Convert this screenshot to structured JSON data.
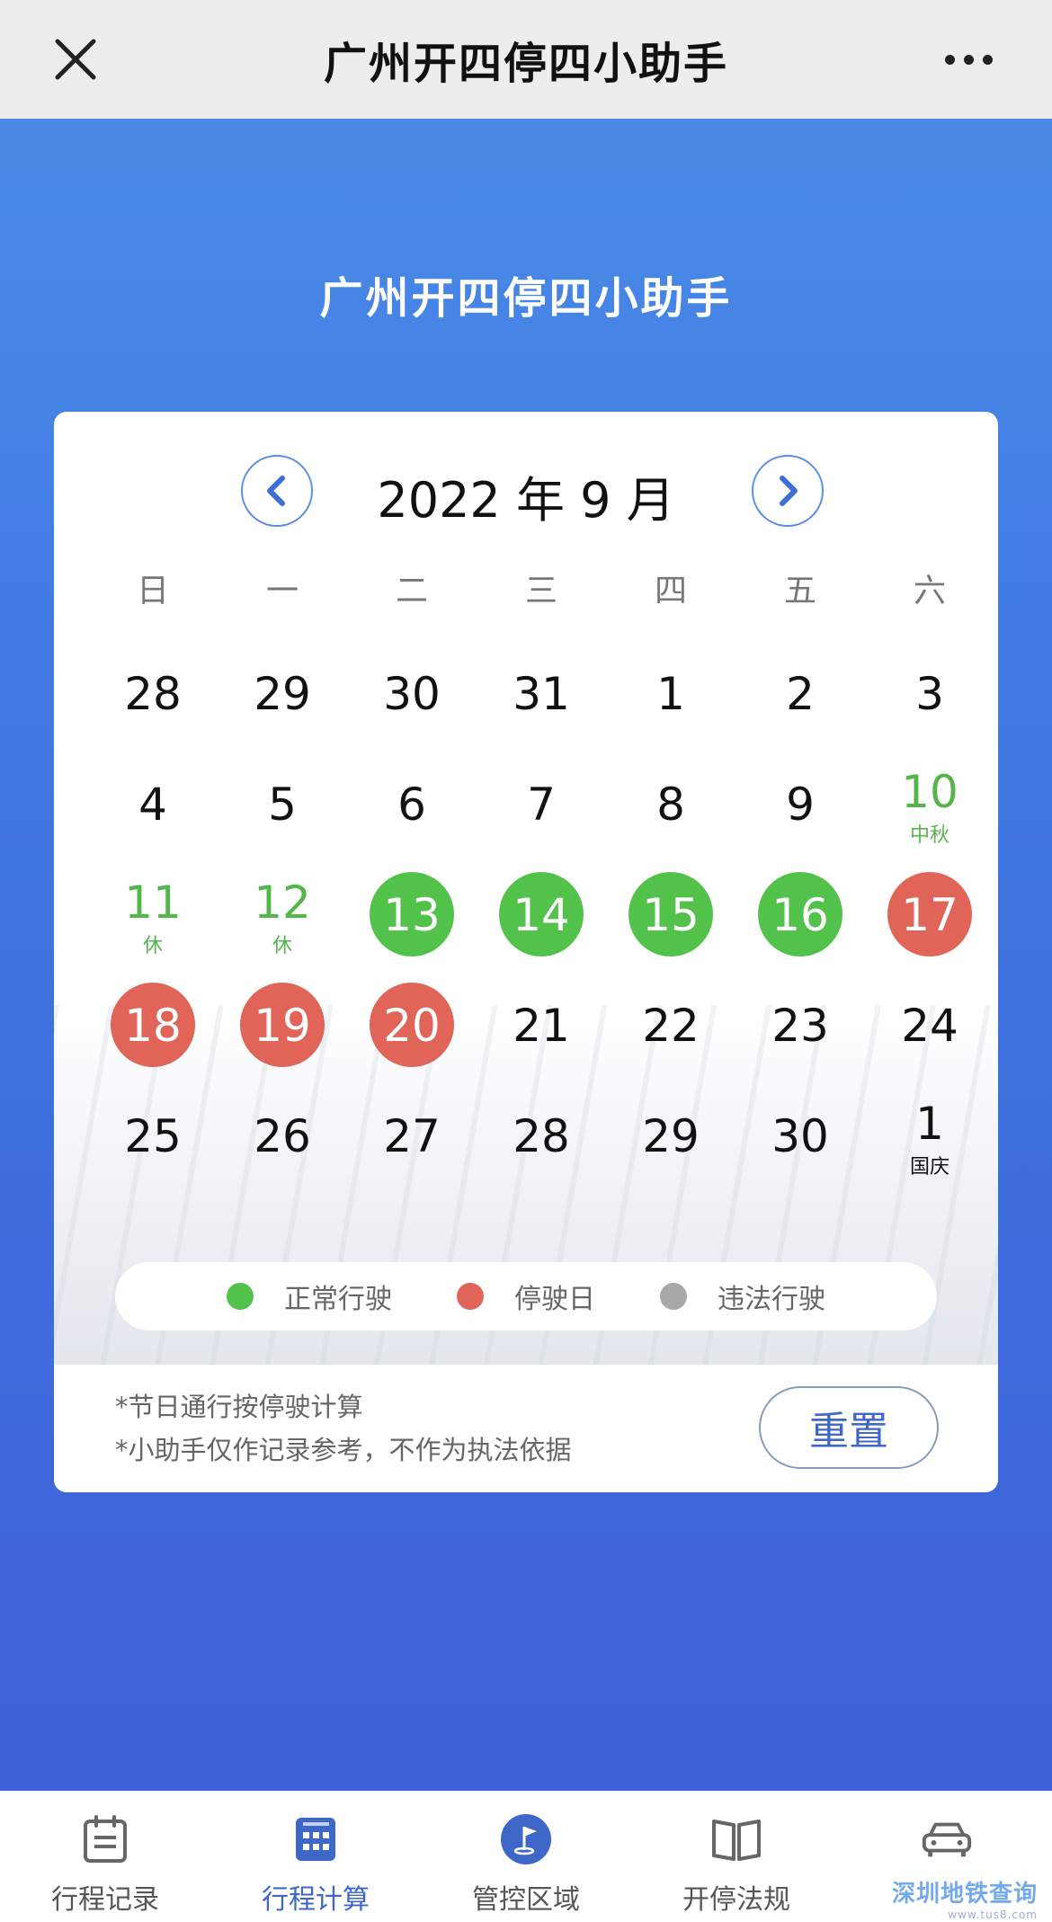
{
  "window": {
    "title": "广州开四停四小助手"
  },
  "hero": {
    "title": "广州开四停四小助手"
  },
  "calendar": {
    "month_label": "2022 年 9 月",
    "weekdays": [
      "日",
      "一",
      "二",
      "三",
      "四",
      "五",
      "六"
    ],
    "days": [
      {
        "n": "28",
        "s": "normal",
        "note": ""
      },
      {
        "n": "29",
        "s": "normal",
        "note": ""
      },
      {
        "n": "30",
        "s": "normal",
        "note": ""
      },
      {
        "n": "31",
        "s": "normal",
        "note": ""
      },
      {
        "n": "1",
        "s": "normal",
        "note": ""
      },
      {
        "n": "2",
        "s": "normal",
        "note": ""
      },
      {
        "n": "3",
        "s": "normal",
        "note": ""
      },
      {
        "n": "4",
        "s": "normal",
        "note": ""
      },
      {
        "n": "5",
        "s": "normal",
        "note": ""
      },
      {
        "n": "6",
        "s": "normal",
        "note": ""
      },
      {
        "n": "7",
        "s": "normal",
        "note": ""
      },
      {
        "n": "8",
        "s": "normal",
        "note": ""
      },
      {
        "n": "9",
        "s": "normal",
        "note": ""
      },
      {
        "n": "10",
        "s": "holiday",
        "note": "中秋"
      },
      {
        "n": "11",
        "s": "holiday",
        "note": "休"
      },
      {
        "n": "12",
        "s": "holiday",
        "note": "休"
      },
      {
        "n": "13",
        "s": "green",
        "note": ""
      },
      {
        "n": "14",
        "s": "green",
        "note": ""
      },
      {
        "n": "15",
        "s": "green",
        "note": ""
      },
      {
        "n": "16",
        "s": "green",
        "note": ""
      },
      {
        "n": "17",
        "s": "red",
        "note": ""
      },
      {
        "n": "18",
        "s": "red",
        "note": ""
      },
      {
        "n": "19",
        "s": "red",
        "note": ""
      },
      {
        "n": "20",
        "s": "red",
        "note": ""
      },
      {
        "n": "21",
        "s": "normal",
        "note": ""
      },
      {
        "n": "22",
        "s": "normal",
        "note": ""
      },
      {
        "n": "23",
        "s": "normal",
        "note": ""
      },
      {
        "n": "24",
        "s": "normal",
        "note": ""
      },
      {
        "n": "25",
        "s": "normal",
        "note": ""
      },
      {
        "n": "26",
        "s": "normal",
        "note": ""
      },
      {
        "n": "27",
        "s": "normal",
        "note": ""
      },
      {
        "n": "28",
        "s": "normal",
        "note": ""
      },
      {
        "n": "29",
        "s": "normal",
        "note": ""
      },
      {
        "n": "30",
        "s": "normal",
        "note": ""
      },
      {
        "n": "1",
        "s": "black-note",
        "note": "国庆"
      }
    ]
  },
  "legend": [
    {
      "label": "正常行驶",
      "color": "#53c24b"
    },
    {
      "label": "停驶日",
      "color": "#e06558"
    },
    {
      "label": "违法行驶",
      "color": "#a8a8a8"
    }
  ],
  "footer": {
    "note1": "*节日通行按停驶计算",
    "note2": "*小助手仅作记录参考，不作为执法依据",
    "reset_label": "重置"
  },
  "tabs": [
    {
      "label": "行程记录",
      "icon": "clipboard-icon",
      "active": false
    },
    {
      "label": "行程计算",
      "icon": "calculator-icon",
      "active": true
    },
    {
      "label": "管控区域",
      "icon": "map-flag-icon",
      "active": false
    },
    {
      "label": "开停法规",
      "icon": "book-icon",
      "active": false
    },
    {
      "label": "",
      "icon": "car-icon",
      "active": false
    }
  ],
  "watermark": {
    "text": "深圳地铁查询",
    "sub": "www.tus8.com"
  },
  "colors": {
    "accent": "#3f67c8",
    "green": "#53c24b",
    "red": "#e06558",
    "gray": "#a8a8a8"
  }
}
